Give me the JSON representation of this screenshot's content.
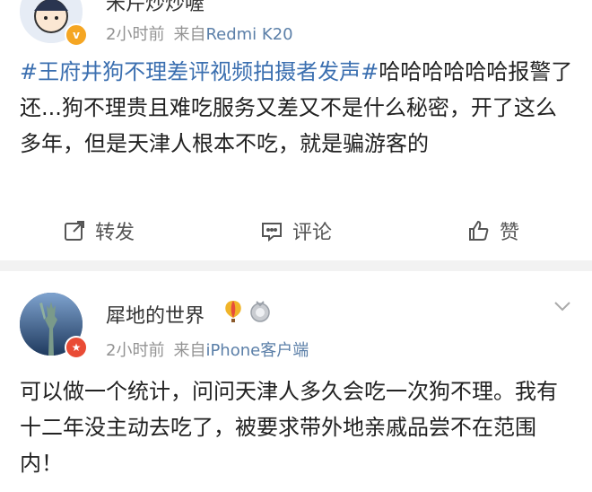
{
  "post1": {
    "username": "米芹炒炒喔",
    "time": "2小时前",
    "source_prefix": "来自",
    "device": "Redmi K20",
    "topic": "#王府井狗不理差评视频拍摄者发声#",
    "body": "哈哈哈哈哈哈报警了还...狗不理贵且难吃服务又差又不是什么秘密，开了这么多年，但是天津人根本不吃，就是骗游客的",
    "actions": {
      "repost": "转发",
      "comment": "评论",
      "like": "赞"
    }
  },
  "post2": {
    "username": "犀地的世界",
    "time": "2小时前",
    "source_prefix": "来自",
    "device": "iPhone客户端",
    "body": "可以做一个统计，问问天津人多久会吃一次狗不理。我有十二年没主动去吃了，被要求带外地亲戚品尝不在范围内！"
  },
  "colors": {
    "link": "#3b6fb0",
    "meta": "#939393",
    "divider": "#f2f2f2"
  },
  "icons": [
    "repost-icon",
    "comment-icon",
    "like-icon",
    "chevron-down-icon",
    "balloon-icon",
    "medal-icon",
    "verified-badge-icon"
  ]
}
